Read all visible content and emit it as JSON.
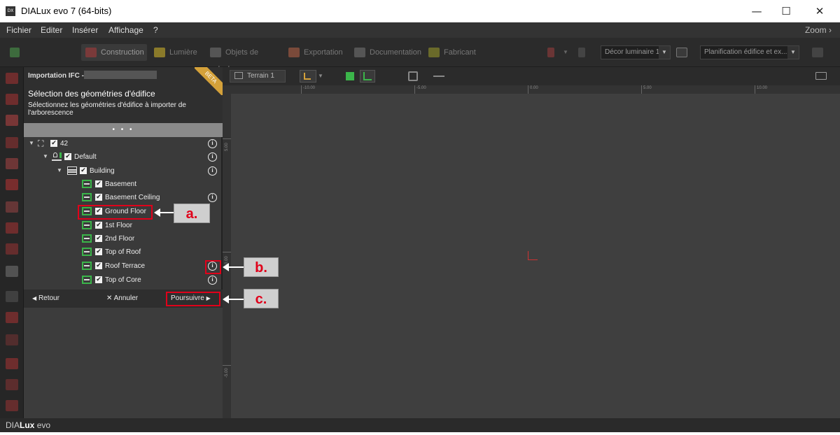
{
  "window": {
    "title": "DIALux evo 7  (64-bits)",
    "app_icon_text": "DX",
    "minimize_glyph": "—",
    "maximize_glyph": "☐",
    "close_glyph": "✕"
  },
  "menu": {
    "items": [
      "Fichier",
      "Editer",
      "Insérer",
      "Affichage",
      "?"
    ],
    "zoom_label": "Zoom"
  },
  "toolbar": {
    "tabs": [
      {
        "label": "Construction",
        "active": true
      },
      {
        "label": "Lumière",
        "active": false
      },
      {
        "label": "Objets de calcul",
        "active": false
      },
      {
        "label": "Exportation",
        "active": false
      },
      {
        "label": "Documentation",
        "active": false
      },
      {
        "label": "Fabricant",
        "active": false
      }
    ],
    "decor_dropdown": "Décor luminaire 1",
    "planning_dropdown": "Planification édifice et ex..."
  },
  "panel": {
    "header": "Importation IFC -",
    "badge": "BETA",
    "title": "Sélection des géométries d'édifice",
    "description": "Sélectionnez les géométries d'édifice à importer de l'arborescence",
    "dots": "• • •",
    "tree": [
      {
        "label": "42",
        "level": 0,
        "expanded": true,
        "info": true
      },
      {
        "label": "Default",
        "level": 1,
        "expanded": true,
        "info": true
      },
      {
        "label": "Building",
        "level": 2,
        "expanded": true,
        "info": true
      },
      {
        "label": "Basement",
        "level": 3,
        "info": false
      },
      {
        "label": "Basement Ceiling",
        "level": 3,
        "info": true
      },
      {
        "label": "Ground Floor",
        "level": 3,
        "info": false
      },
      {
        "label": "1st Floor",
        "level": 3,
        "info": false
      },
      {
        "label": "2nd Floor",
        "level": 3,
        "info": false
      },
      {
        "label": "Top of Roof",
        "level": 3,
        "info": false
      },
      {
        "label": "Roof Terrace",
        "level": 3,
        "info": true
      },
      {
        "label": "Top of Core",
        "level": 3,
        "info": true
      }
    ],
    "footer": {
      "back": "Retour",
      "cancel": "Annuler",
      "continue": "Poursuivre"
    }
  },
  "viewbar": {
    "terrain_label": "Terrain 1"
  },
  "ruler": {
    "h_ticks": [
      "-10.00",
      "-5.00",
      "0.00",
      "5.00",
      "10.00"
    ],
    "v_ticks": [
      "5.00",
      "0.00",
      "-5.00"
    ]
  },
  "status": {
    "brand_a": "DIA",
    "brand_b": "Lux",
    "brand_c": " evo"
  },
  "annotations": {
    "a": "a.",
    "b": "b.",
    "c": "c."
  },
  "colors": {
    "accent_red": "#e0001a",
    "beta_badge": "#d4a13a",
    "floor_green": "#3bb54a"
  },
  "icons": {
    "check": "✔",
    "info": "i",
    "triangle_down": "▼",
    "back_arrow": "◀",
    "cancel_x": "✕",
    "continue_arrow": "▶"
  }
}
